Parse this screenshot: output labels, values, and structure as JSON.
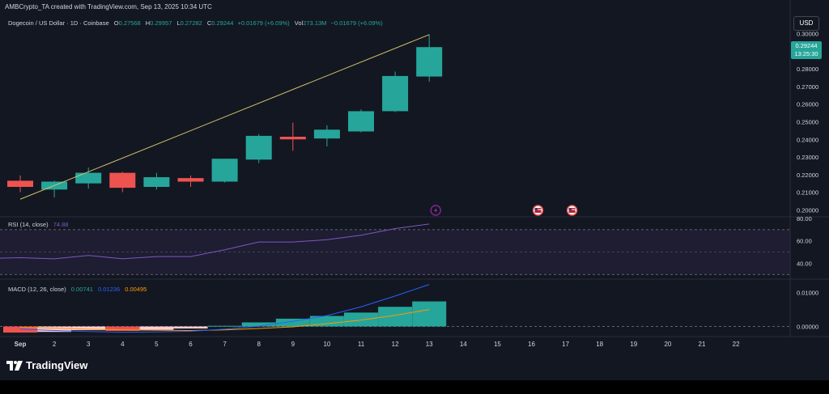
{
  "header": {
    "creator": "AMBCrypto_TA created with TradingView.com, Sep 13, 2025 10:34 UTC",
    "currency_button": "USD"
  },
  "legend": {
    "symbol": "Dogecoin / US Dollar · 1D · Coinbase",
    "open_label": "O",
    "open": "0.27568",
    "high_label": "H",
    "high": "0.29957",
    "low_label": "L",
    "low": "0.27282",
    "close_label": "C",
    "close": "0.29244",
    "change": "+0.01679 (+6.09%)",
    "vol_label": "Vol",
    "vol": "273.13M",
    "change2": "−0.01679 (+6.09%)"
  },
  "price_tag": {
    "price": "0.29244",
    "countdown": "13:25:30"
  },
  "rsi_legend": {
    "name": "RSI (14, close)",
    "value": "74.88"
  },
  "macd_legend": {
    "name": "MACD (12, 26, close)",
    "v1": "0.00741",
    "v2": "0.01236",
    "v3": "0.00495"
  },
  "branding": {
    "logo_text": "TradingView"
  },
  "colors": {
    "up": "#26a69a",
    "down": "#ef5350",
    "rsi": "#7e57c2",
    "macd": "#2962ff",
    "signal": "#ff9800",
    "trendline": "#d4c06a"
  },
  "chart_data": {
    "type": "candlestick",
    "x": [
      "Sep",
      "2",
      "3",
      "4",
      "5",
      "6",
      "7",
      "8",
      "9",
      "10",
      "11",
      "12",
      "13"
    ],
    "x_axis_ticks": [
      "Sep",
      "2",
      "3",
      "4",
      "5",
      "6",
      "7",
      "8",
      "9",
      "10",
      "11",
      "12",
      "13",
      "14",
      "15",
      "16",
      "17",
      "18",
      "19",
      "20",
      "21",
      "22"
    ],
    "price_axis_ticks": [
      "0.30000",
      "0.29000",
      "0.28000",
      "0.27000",
      "0.26000",
      "0.25000",
      "0.24000",
      "0.23000",
      "0.22000",
      "0.21000",
      "0.20000"
    ],
    "ylim": [
      0.196,
      0.304
    ],
    "candles": [
      {
        "o": 0.2165,
        "h": 0.2195,
        "l": 0.21,
        "c": 0.213
      },
      {
        "o": 0.2115,
        "h": 0.2165,
        "l": 0.207,
        "c": 0.216
      },
      {
        "o": 0.215,
        "h": 0.224,
        "l": 0.212,
        "c": 0.221
      },
      {
        "o": 0.221,
        "h": 0.2215,
        "l": 0.21,
        "c": 0.2125
      },
      {
        "o": 0.213,
        "h": 0.221,
        "l": 0.2115,
        "c": 0.2185
      },
      {
        "o": 0.218,
        "h": 0.2195,
        "l": 0.213,
        "c": 0.216
      },
      {
        "o": 0.216,
        "h": 0.229,
        "l": 0.2155,
        "c": 0.229
      },
      {
        "o": 0.2285,
        "h": 0.243,
        "l": 0.2265,
        "c": 0.242
      },
      {
        "o": 0.2415,
        "h": 0.2495,
        "l": 0.2335,
        "c": 0.24
      },
      {
        "o": 0.2405,
        "h": 0.248,
        "l": 0.236,
        "c": 0.2455
      },
      {
        "o": 0.2445,
        "h": 0.257,
        "l": 0.244,
        "c": 0.256
      },
      {
        "o": 0.256,
        "h": 0.2785,
        "l": 0.2555,
        "c": 0.276
      },
      {
        "o": 0.2757,
        "h": 0.2996,
        "l": 0.2728,
        "c": 0.2924
      }
    ],
    "trendline": [
      {
        "x": 0,
        "y": 0.206
      },
      {
        "x": 12,
        "y": 0.2995
      }
    ],
    "event_markers": [
      {
        "x": 12,
        "icon": "lightning-icon"
      },
      {
        "x": 15,
        "icon": "us-flag-icon"
      },
      {
        "x": 16,
        "icon": "us-flag-icon"
      }
    ],
    "rsi": {
      "ticks": [
        "80.00",
        "60.00",
        "40.00"
      ],
      "ylim": [
        28,
        80
      ],
      "band": [
        30,
        70
      ],
      "values": [
        45,
        44,
        47,
        44,
        46,
        46,
        52,
        59,
        59,
        61,
        65,
        71,
        75
      ]
    },
    "macd": {
      "ticks": [
        "0.01000",
        "0.00000"
      ],
      "ylim": [
        -0.0025,
        0.0135
      ],
      "histogram": [
        -0.0018,
        -0.0016,
        -0.0011,
        -0.0013,
        -0.001,
        -0.0006,
        0.0002,
        0.0012,
        0.0023,
        0.0031,
        0.0041,
        0.0058,
        0.0074
      ],
      "macd_line": [
        -0.0008,
        -0.0012,
        -0.0015,
        -0.0017,
        -0.0016,
        -0.0014,
        -0.0008,
        0.0001,
        0.0015,
        0.0032,
        0.0058,
        0.009,
        0.0124
      ],
      "signal_line": [
        -0.0002,
        -0.0005,
        -0.0008,
        -0.001,
        -0.0011,
        -0.0012,
        -0.001,
        -0.0006,
        -0.0001,
        0.0008,
        0.0019,
        0.0033,
        0.005
      ]
    }
  }
}
